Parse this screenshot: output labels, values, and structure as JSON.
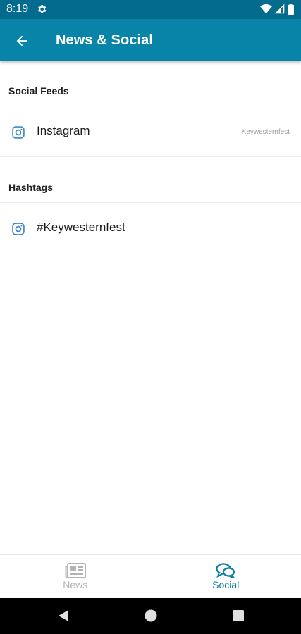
{
  "status_bar": {
    "time": "8:19",
    "icons": [
      "settings-gear-icon",
      "wifi-icon",
      "signal-icon",
      "battery-icon"
    ]
  },
  "app_bar": {
    "title": "News & Social",
    "back_icon": "arrow-left-icon",
    "background_color": "#0784a8"
  },
  "sections": {
    "social_feeds": {
      "header": "Social Feeds",
      "items": [
        {
          "icon": "instagram-icon",
          "label": "Instagram",
          "detail": "Keywesternfest"
        }
      ]
    },
    "hashtags": {
      "header": "Hashtags",
      "items": [
        {
          "icon": "instagram-icon",
          "label": "#Keywesternfest"
        }
      ]
    }
  },
  "bottom_nav": {
    "items": [
      {
        "label": "News",
        "icon": "newspaper-icon",
        "active": false
      },
      {
        "label": "Social",
        "icon": "chat-bubbles-icon",
        "active": true
      }
    ],
    "active_color": "#0a7ea6",
    "inactive_color": "#b3b3b3"
  },
  "system_nav": {
    "buttons": [
      "back-triangle-icon",
      "home-circle-icon",
      "recents-square-icon"
    ]
  }
}
